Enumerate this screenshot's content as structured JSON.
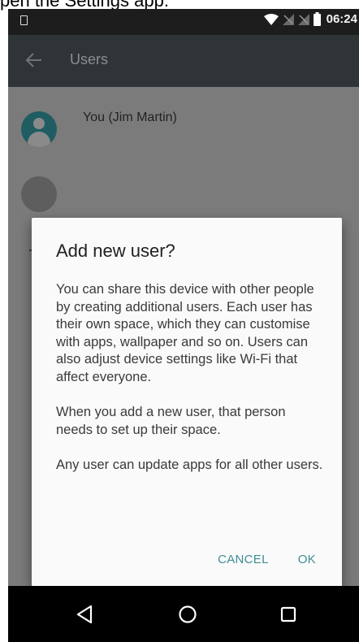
{
  "caption": "pen the Settings app.",
  "status_bar": {
    "time": "06:24",
    "icons": [
      "notification-icon",
      "wifi-icon",
      "signal-icon",
      "signal-icon",
      "battery-icon"
    ]
  },
  "toolbar": {
    "title": "Users",
    "back_icon": "arrow-back-icon"
  },
  "users_list": {
    "current_user": "You (Jim Martin)"
  },
  "dialog": {
    "title": "Add new user?",
    "paragraphs": [
      "You can share this device with other people by creating additional users. Each user has their own space, which they can customise with apps, wallpaper and so on. Users can also adjust device settings like Wi-Fi that affect everyone.",
      "When you add a new user, that person needs to set up their space.",
      "Any user can update apps for all other users."
    ],
    "cancel_label": "CANCEL",
    "ok_label": "OK"
  },
  "colors": {
    "accent": "#3f8d96",
    "toolbar": "#2f3437",
    "status_bar": "#1d1d1d",
    "scrim_background": "#7b7b7b",
    "dialog_background": "#fafafa"
  },
  "nav_bar": {
    "buttons": [
      "back-triangle-icon",
      "home-circle-icon",
      "recents-square-icon"
    ]
  }
}
